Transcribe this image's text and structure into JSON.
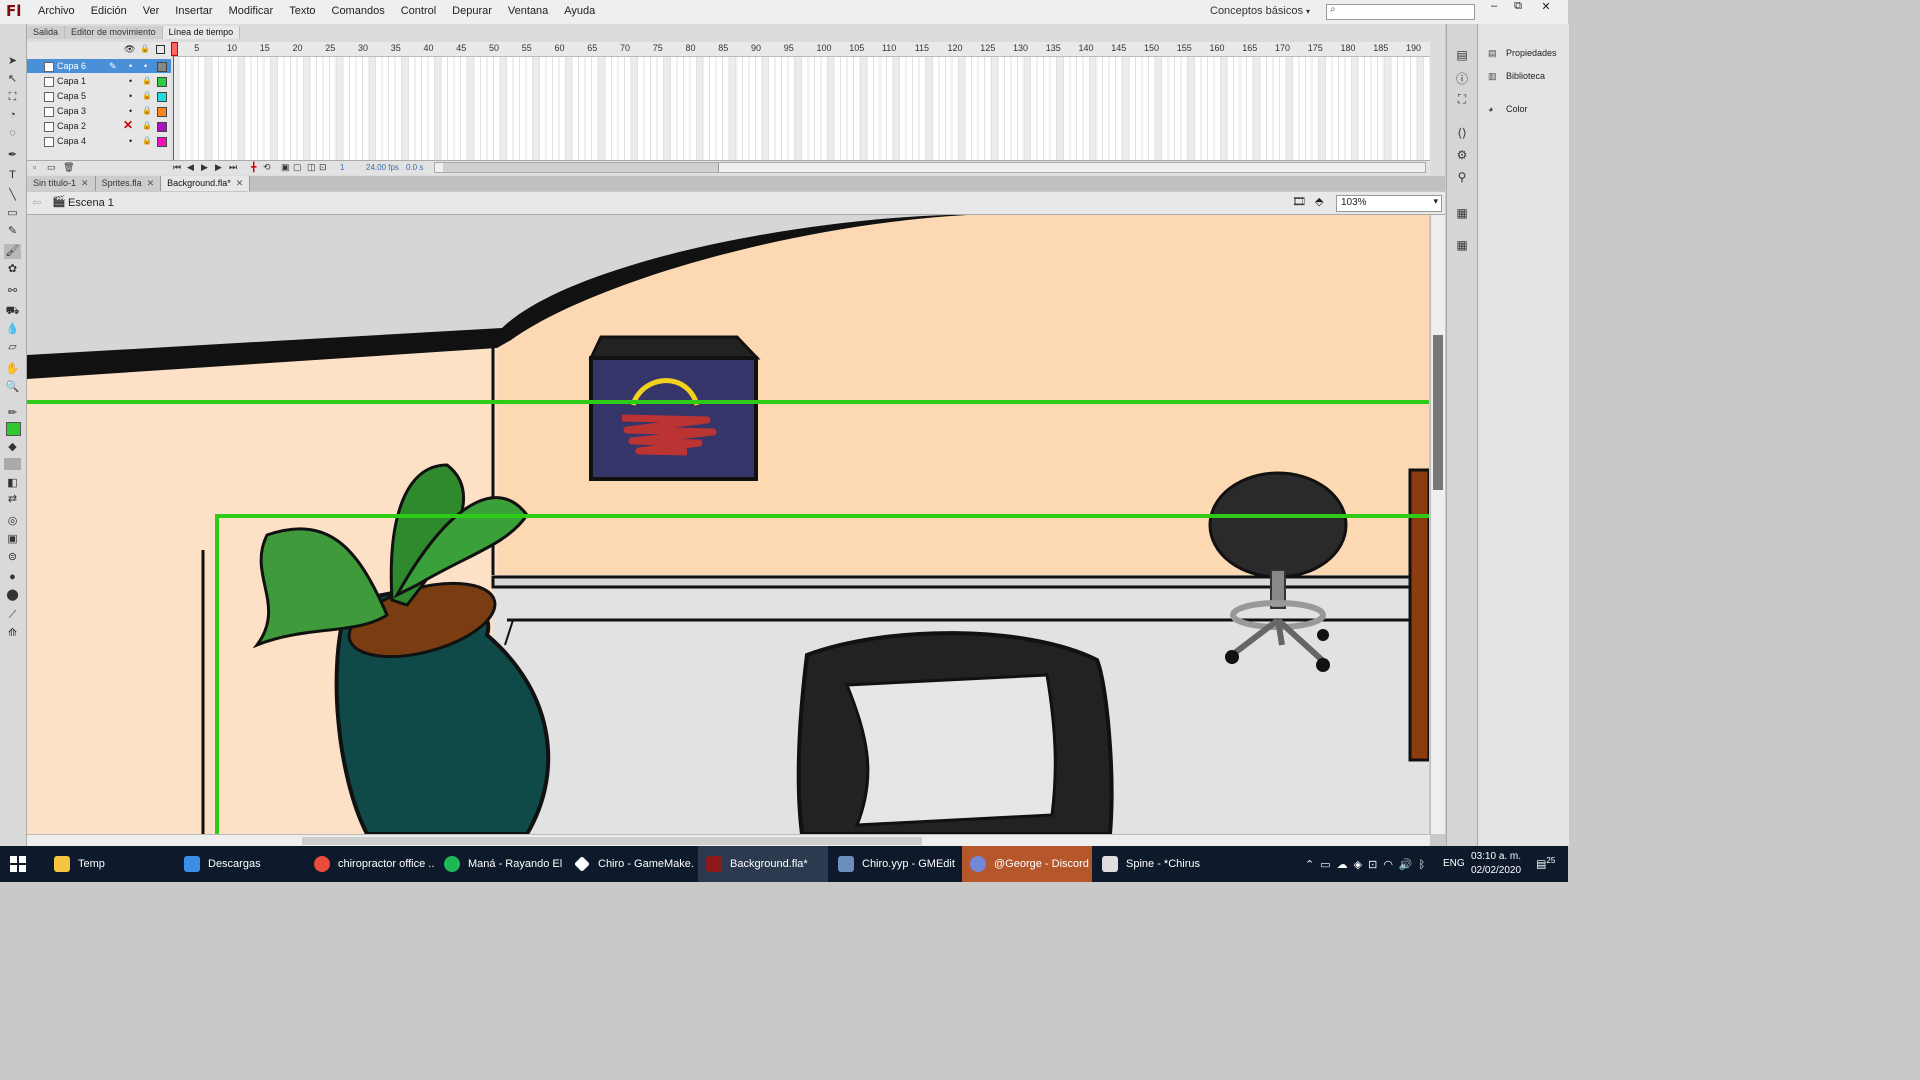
{
  "app": {
    "logo": "Fl"
  },
  "menu": [
    "Archivo",
    "Edición",
    "Ver",
    "Insertar",
    "Modificar",
    "Texto",
    "Comandos",
    "Control",
    "Depurar",
    "Ventana",
    "Ayuda"
  ],
  "workspace": "Conceptos básicos",
  "window_buttons": [
    "‒",
    "⧉",
    "✕"
  ],
  "panel_tabs": [
    "Salida",
    "Editor de movimiento",
    "Línea de tiempo"
  ],
  "layers": [
    {
      "name": "Capa 6",
      "color": "#4a90d9",
      "selected": true
    },
    {
      "name": "Capa 1",
      "color": "#2ecc40"
    },
    {
      "name": "Capa 5",
      "color": "#22dddd"
    },
    {
      "name": "Capa 3",
      "color": "#ff851b"
    },
    {
      "name": "Capa 2",
      "color": "#b10dc9",
      "hidden_x": true
    },
    {
      "name": "Capa 4",
      "color": "#f012be"
    }
  ],
  "ruler": [
    "1",
    "5",
    "10",
    "15",
    "20",
    "25",
    "30",
    "35",
    "40",
    "45",
    "50",
    "55",
    "60",
    "65",
    "70",
    "75",
    "80",
    "85",
    "90",
    "95",
    "100",
    "105",
    "110",
    "115",
    "120",
    "125",
    "130",
    "135",
    "140",
    "145",
    "150",
    "155",
    "160",
    "165",
    "170",
    "175",
    "180",
    "185",
    "190"
  ],
  "timeline_footer": {
    "frame": "1",
    "fps": "24.00 fps",
    "time": "0.0 s"
  },
  "doc_tabs": [
    {
      "label": "Sin título-1",
      "active": false
    },
    {
      "label": "Sprites.fla",
      "active": false
    },
    {
      "label": "Background.fla*",
      "active": true
    }
  ],
  "scene": "Escena 1",
  "zoom": "103%",
  "right_panel": [
    "Propiedades",
    "Biblioteca",
    "Color"
  ],
  "taskbar": [
    {
      "label": "Temp",
      "color": "#f5c542"
    },
    {
      "label": "Descargas",
      "color": "#3a8ee6"
    },
    {
      "label": "chiropractor office ...",
      "color": "#e74c3c"
    },
    {
      "label": "Maná - Rayando El ...",
      "color": "#1db954"
    },
    {
      "label": "Chiro - GameMake...",
      "color": "#ffffff"
    },
    {
      "label": "Background.fla*",
      "color": "#8b1a1a",
      "active": true
    },
    {
      "label": "Chiro.yyp - GMEdit",
      "color": "#6c8ebf"
    },
    {
      "label": "@George - Discord",
      "color": "#7289da",
      "highlight": true
    },
    {
      "label": "Spine - *Chirus",
      "color": "#dddddd"
    }
  ],
  "tray": {
    "lang": "ENG",
    "time": "03:10 a. m.",
    "date": "02/02/2020",
    "notifications": "25"
  }
}
